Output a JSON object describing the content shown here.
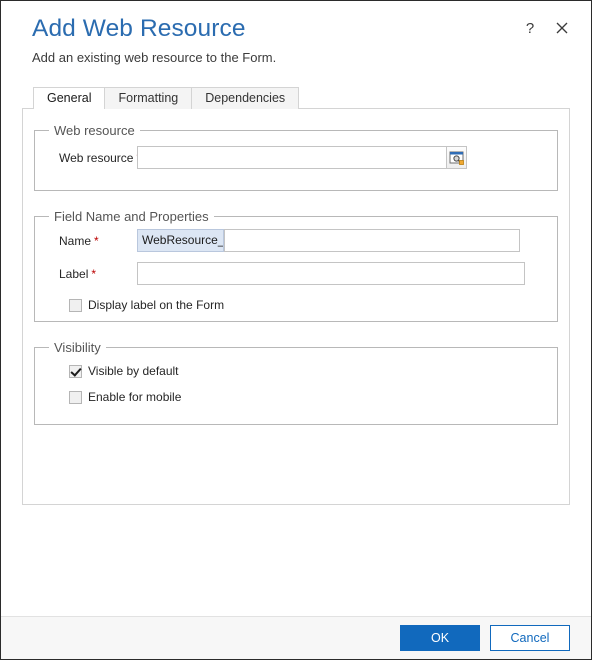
{
  "dialog": {
    "title": "Add Web Resource",
    "subtitle": "Add an existing web resource to the Form.",
    "help_icon": "question-mark-icon",
    "close_icon": "close-icon",
    "accent_color": "#1169bd",
    "title_color": "#2b6cb0",
    "required_marker": "*",
    "required_color": "#bb0000"
  },
  "tabs": [
    {
      "label": "General",
      "active": true
    },
    {
      "label": "Formatting",
      "active": false
    },
    {
      "label": "Dependencies",
      "active": false
    }
  ],
  "sections": {
    "web_resource": {
      "legend": "Web resource",
      "field_label": "Web resource",
      "required": true,
      "value": "",
      "lookup_icon": "lookup-browse-icon"
    },
    "field_name_properties": {
      "legend": "Field Name and Properties",
      "name": {
        "label": "Name",
        "required": true,
        "prefix": "WebResource_",
        "value": ""
      },
      "label_field": {
        "label": "Label",
        "required": true,
        "value": ""
      },
      "display_label_checkbox": {
        "label": "Display label on the Form",
        "checked": false
      }
    },
    "visibility": {
      "legend": "Visibility",
      "options": [
        {
          "label": "Visible by default",
          "checked": true
        },
        {
          "label": "Enable for mobile",
          "checked": false
        }
      ]
    }
  },
  "footer": {
    "ok_label": "OK",
    "cancel_label": "Cancel"
  }
}
